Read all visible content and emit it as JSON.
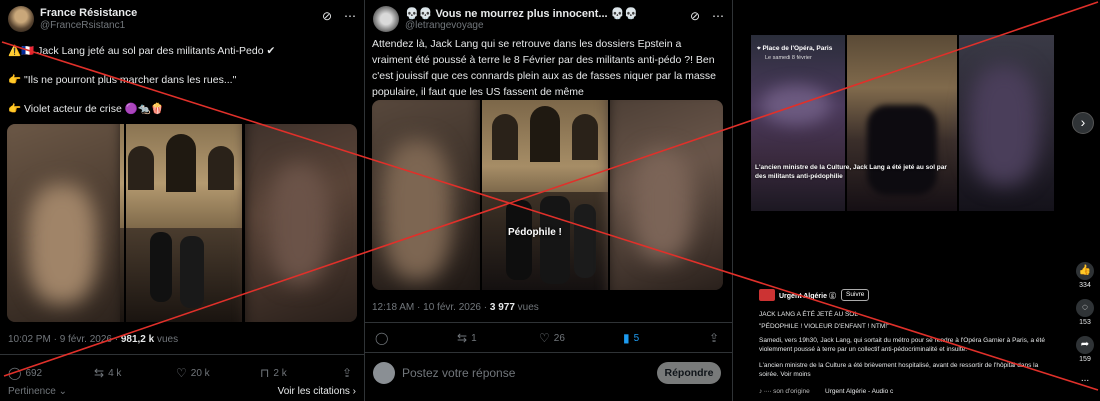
{
  "post1": {
    "name": "France Résistance",
    "handle": "@FranceRsistanc1",
    "line1": "⚠️🇫🇷 Jack Lang jeté au sol par des militants Anti-Pedo ✔",
    "line2": "👉 \"Ils ne pourront plus marcher dans les rues...\"",
    "line3": "👉 Violet acteur de crise 🟣🐀🍿",
    "time": "10:02 PM · 9 févr. 2026 · ",
    "views": "981,2 k",
    "views_label": " vues",
    "replies": "692",
    "reposts": "4 k",
    "likes": "20 k",
    "bookmarks": "2 k",
    "sort_label": "Pertinence ⌄",
    "quotes_link": "Voir les citations ›"
  },
  "post2": {
    "name": "💀💀 Vous ne mourrez plus innocent... 💀💀",
    "handle": "@letrangevoyage",
    "text": "Attendez là, Jack Lang qui se retrouve dans les dossiers Epstein a vraiment été poussé à terre le 8 Février par des militants anti-pédo ?! Ben c'est jouissif que ces connards plein aux as de fasses niquer par la masse populaire, il faut que les US fassent de même",
    "video_caption": "Pédophile !",
    "time": "12:18 AM · 10 févr. 2026 · ",
    "views": "3 977",
    "views_label": " vues",
    "replies": "",
    "reposts": "1",
    "likes": "26",
    "bookmarks": "5",
    "reply_placeholder": "Postez votre réponse",
    "reply_button": "Répondre"
  },
  "post3": {
    "location": "Place de l'Opéra, Paris",
    "date_line": "Le samedi 8 février",
    "overlay_caption": "L'ancien ministre de la Culture, Jack Lang a été jeté au sol par des militants anti-pédophilie",
    "author": "Urgent Algérie",
    "follow": "Suivre",
    "title1": "JACK LANG A ÉTÉ JETÉ AU SOL",
    "title2": "\"PÉDOPHILE ! VIOLEUR D'ENFANT ! NTM!\"",
    "body1": "Samedi, vers 19h30, Jack Lang, qui sortait du métro pour se rendre à l'Opéra Garnier à Paris, a été violemment poussé à terre par un collectif anti-pédocriminalité et insulté.",
    "body2": "L'ancien ministre de la Culture a été brièvement hospitalisé, avant de ressortir de l'hôpital dans la soirée. Voir moins",
    "sound": "♪ ∙∙∙∙ son d'origine",
    "sound_author": "Urgent Algérie - Audio c",
    "likes": "334",
    "comments": "153",
    "shares": "159",
    "more": "..."
  },
  "colors": {
    "cross": "#e0302a",
    "bookmark_active": "#1d9bf0"
  }
}
